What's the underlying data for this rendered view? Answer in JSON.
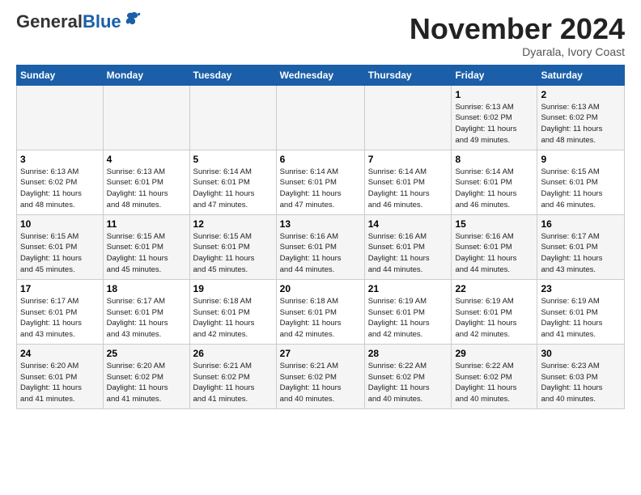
{
  "header": {
    "logo_general": "General",
    "logo_blue": "Blue",
    "month_title": "November 2024",
    "location": "Dyarala, Ivory Coast"
  },
  "weekdays": [
    "Sunday",
    "Monday",
    "Tuesday",
    "Wednesday",
    "Thursday",
    "Friday",
    "Saturday"
  ],
  "weeks": [
    [
      {
        "day": "",
        "info": ""
      },
      {
        "day": "",
        "info": ""
      },
      {
        "day": "",
        "info": ""
      },
      {
        "day": "",
        "info": ""
      },
      {
        "day": "",
        "info": ""
      },
      {
        "day": "1",
        "info": "Sunrise: 6:13 AM\nSunset: 6:02 PM\nDaylight: 11 hours\nand 49 minutes."
      },
      {
        "day": "2",
        "info": "Sunrise: 6:13 AM\nSunset: 6:02 PM\nDaylight: 11 hours\nand 48 minutes."
      }
    ],
    [
      {
        "day": "3",
        "info": "Sunrise: 6:13 AM\nSunset: 6:02 PM\nDaylight: 11 hours\nand 48 minutes."
      },
      {
        "day": "4",
        "info": "Sunrise: 6:13 AM\nSunset: 6:01 PM\nDaylight: 11 hours\nand 48 minutes."
      },
      {
        "day": "5",
        "info": "Sunrise: 6:14 AM\nSunset: 6:01 PM\nDaylight: 11 hours\nand 47 minutes."
      },
      {
        "day": "6",
        "info": "Sunrise: 6:14 AM\nSunset: 6:01 PM\nDaylight: 11 hours\nand 47 minutes."
      },
      {
        "day": "7",
        "info": "Sunrise: 6:14 AM\nSunset: 6:01 PM\nDaylight: 11 hours\nand 46 minutes."
      },
      {
        "day": "8",
        "info": "Sunrise: 6:14 AM\nSunset: 6:01 PM\nDaylight: 11 hours\nand 46 minutes."
      },
      {
        "day": "9",
        "info": "Sunrise: 6:15 AM\nSunset: 6:01 PM\nDaylight: 11 hours\nand 46 minutes."
      }
    ],
    [
      {
        "day": "10",
        "info": "Sunrise: 6:15 AM\nSunset: 6:01 PM\nDaylight: 11 hours\nand 45 minutes."
      },
      {
        "day": "11",
        "info": "Sunrise: 6:15 AM\nSunset: 6:01 PM\nDaylight: 11 hours\nand 45 minutes."
      },
      {
        "day": "12",
        "info": "Sunrise: 6:15 AM\nSunset: 6:01 PM\nDaylight: 11 hours\nand 45 minutes."
      },
      {
        "day": "13",
        "info": "Sunrise: 6:16 AM\nSunset: 6:01 PM\nDaylight: 11 hours\nand 44 minutes."
      },
      {
        "day": "14",
        "info": "Sunrise: 6:16 AM\nSunset: 6:01 PM\nDaylight: 11 hours\nand 44 minutes."
      },
      {
        "day": "15",
        "info": "Sunrise: 6:16 AM\nSunset: 6:01 PM\nDaylight: 11 hours\nand 44 minutes."
      },
      {
        "day": "16",
        "info": "Sunrise: 6:17 AM\nSunset: 6:01 PM\nDaylight: 11 hours\nand 43 minutes."
      }
    ],
    [
      {
        "day": "17",
        "info": "Sunrise: 6:17 AM\nSunset: 6:01 PM\nDaylight: 11 hours\nand 43 minutes."
      },
      {
        "day": "18",
        "info": "Sunrise: 6:17 AM\nSunset: 6:01 PM\nDaylight: 11 hours\nand 43 minutes."
      },
      {
        "day": "19",
        "info": "Sunrise: 6:18 AM\nSunset: 6:01 PM\nDaylight: 11 hours\nand 42 minutes."
      },
      {
        "day": "20",
        "info": "Sunrise: 6:18 AM\nSunset: 6:01 PM\nDaylight: 11 hours\nand 42 minutes."
      },
      {
        "day": "21",
        "info": "Sunrise: 6:19 AM\nSunset: 6:01 PM\nDaylight: 11 hours\nand 42 minutes."
      },
      {
        "day": "22",
        "info": "Sunrise: 6:19 AM\nSunset: 6:01 PM\nDaylight: 11 hours\nand 42 minutes."
      },
      {
        "day": "23",
        "info": "Sunrise: 6:19 AM\nSunset: 6:01 PM\nDaylight: 11 hours\nand 41 minutes."
      }
    ],
    [
      {
        "day": "24",
        "info": "Sunrise: 6:20 AM\nSunset: 6:01 PM\nDaylight: 11 hours\nand 41 minutes."
      },
      {
        "day": "25",
        "info": "Sunrise: 6:20 AM\nSunset: 6:02 PM\nDaylight: 11 hours\nand 41 minutes."
      },
      {
        "day": "26",
        "info": "Sunrise: 6:21 AM\nSunset: 6:02 PM\nDaylight: 11 hours\nand 41 minutes."
      },
      {
        "day": "27",
        "info": "Sunrise: 6:21 AM\nSunset: 6:02 PM\nDaylight: 11 hours\nand 40 minutes."
      },
      {
        "day": "28",
        "info": "Sunrise: 6:22 AM\nSunset: 6:02 PM\nDaylight: 11 hours\nand 40 minutes."
      },
      {
        "day": "29",
        "info": "Sunrise: 6:22 AM\nSunset: 6:02 PM\nDaylight: 11 hours\nand 40 minutes."
      },
      {
        "day": "30",
        "info": "Sunrise: 6:23 AM\nSunset: 6:03 PM\nDaylight: 11 hours\nand 40 minutes."
      }
    ]
  ]
}
